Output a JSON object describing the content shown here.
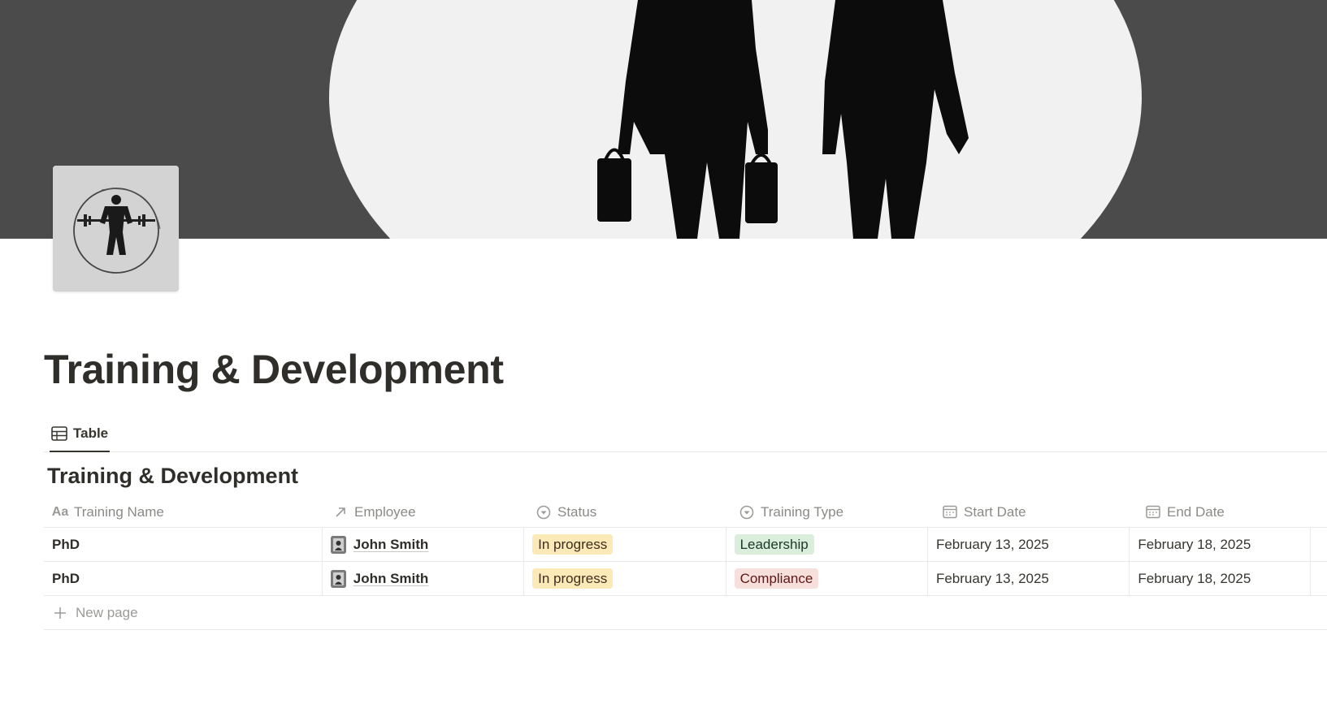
{
  "page": {
    "title": "Training & Development"
  },
  "views": {
    "active_tab": "Table"
  },
  "database": {
    "title": "Training & Development",
    "columns": [
      {
        "label": "Training Name",
        "icon": "text-aa-icon"
      },
      {
        "label": "Employee",
        "icon": "relation-arrow-icon"
      },
      {
        "label": "Status",
        "icon": "status-circle-icon"
      },
      {
        "label": "Training Type",
        "icon": "select-circle-icon"
      },
      {
        "label": "Start Date",
        "icon": "calendar-icon"
      },
      {
        "label": "End Date",
        "icon": "calendar-icon"
      }
    ],
    "rows": [
      {
        "name": "PhD",
        "employee": "John Smith",
        "status": "In progress",
        "training_type": "Leadership",
        "start_date": "February 13, 2025",
        "end_date": "February 18, 2025"
      },
      {
        "name": "PhD",
        "employee": "John Smith",
        "status": "In progress",
        "training_type": "Compliance",
        "start_date": "February 13, 2025",
        "end_date": "February 18, 2025"
      }
    ],
    "new_row_label": "New page"
  },
  "colors": {
    "status_in_progress_bg": "#fbe9b8",
    "status_in_progress_fg": "#402c1b",
    "type_leadership_bg": "#dbeddb",
    "type_leadership_fg": "#1c3829",
    "type_compliance_bg": "#f7e0dc",
    "type_compliance_fg": "#5d1715"
  }
}
